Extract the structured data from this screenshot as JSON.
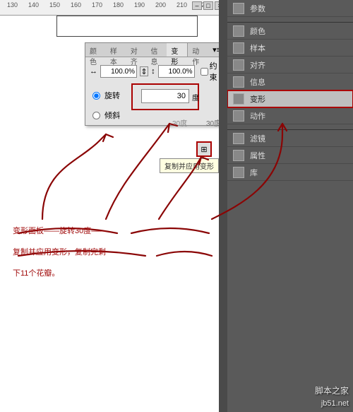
{
  "window": {
    "min": "‒",
    "max": "□",
    "close": "×"
  },
  "ruler": {
    "marks": [
      130,
      140,
      150,
      160,
      170,
      180,
      190,
      200,
      210,
      220
    ]
  },
  "dock": {
    "items": [
      {
        "label": "参数",
        "icon": "params"
      },
      {
        "label": "颜色",
        "icon": "color"
      },
      {
        "label": "样本",
        "icon": "swatch"
      },
      {
        "label": "对齐",
        "icon": "align"
      },
      {
        "label": "信息",
        "icon": "info"
      },
      {
        "label": "变形",
        "icon": "transform",
        "hl": true
      },
      {
        "label": "动作",
        "icon": "action"
      },
      {
        "label": "滤镜",
        "icon": "filter"
      },
      {
        "label": "属性",
        "icon": "attr"
      },
      {
        "label": "库",
        "icon": "library"
      }
    ]
  },
  "panel": {
    "tabs": [
      "颜色",
      "样本",
      "对齐",
      "信息",
      "变形",
      "动作"
    ],
    "active_tab": 4,
    "menu_glyph": "▾≡",
    "scale_w": "100.0%",
    "scale_h": "100.0%",
    "constrain_label": "约束",
    "link_glyph": "⇕",
    "rotate_label": "旋转",
    "shear_label": "倾斜",
    "angle_value": "30",
    "angle_unit": "度",
    "angle_display": "30度",
    "copy_icon": "⊞",
    "tooltip": "复制并应用变形"
  },
  "annotation": {
    "line1": "变形面板——旋转30度——",
    "line2": "复制并应用变形，复制完剩",
    "line3": "下11个花瓣。"
  },
  "watermark": {
    "site": "脚本之家",
    "url": "jb51.net"
  }
}
